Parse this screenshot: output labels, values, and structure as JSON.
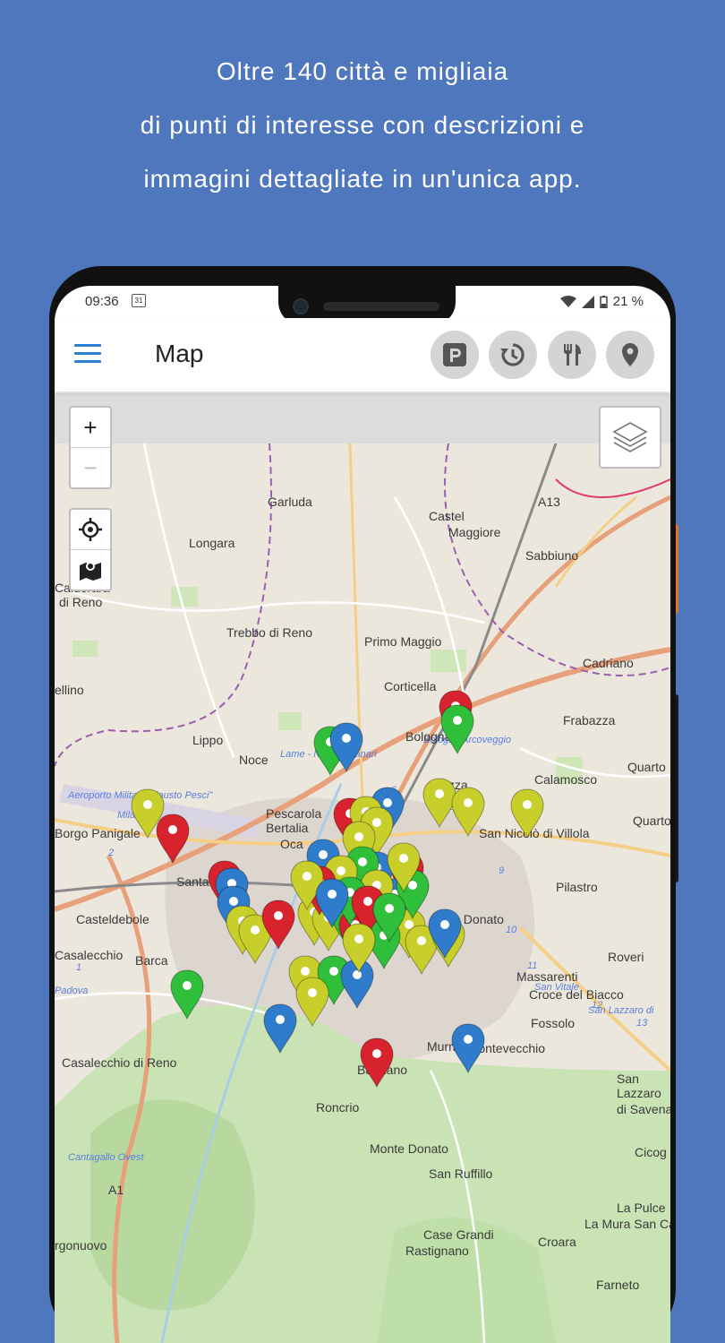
{
  "promo": {
    "line1": "Oltre 140 città e migliaia",
    "line2": "di punti di interesse con descrizioni e",
    "line3": "immagini dettagliate in un'unica app."
  },
  "status_bar": {
    "time": "09:36",
    "calendar_day": "31",
    "battery": "21 %"
  },
  "app_bar": {
    "title": "Map",
    "actions": [
      "parking-icon",
      "history-icon",
      "restaurant-icon",
      "location-pin-icon"
    ]
  },
  "map_controls": {
    "zoom_in": "+",
    "zoom_out": "−"
  },
  "map_labels": [
    "Garluda",
    "Castel",
    "Maggiore",
    "Longara",
    "Sabbiuno",
    "Calderara",
    "di Reno",
    "Trebbo di Reno",
    "Primo Maggio",
    "Cadriano",
    "ellino",
    "Corticella",
    "Frabazza",
    "Lippo",
    "Bologna Arcoveggio",
    "Noce",
    "Lame - Navile - Tanari",
    "Dozza",
    "Quarto In",
    "Calamosco",
    "Aeroporto Militare \"Fausto Pesci\"",
    "Milano",
    "Ferrara",
    "Pescarola",
    "Bertalia",
    "Oca",
    "San Nicolò di Villola",
    "Quarto Sup",
    "Borgo Panigale",
    "Bolognina",
    "San Donato",
    "Pilastro",
    "Santa Viola",
    "Casteldebole",
    "Barca",
    "Roveri",
    "Massarenti",
    "Croce del Biacco",
    "Casalecchio",
    "Padova",
    "Fossolo",
    "San Lazzaro di",
    "Murri",
    "Pontevecchio",
    "Casalecchio di Reno",
    "San",
    "Lazzaro",
    "di Savena",
    "Barbiano",
    "Roncrio",
    "Monte Donato",
    "Cicog",
    "San Ruffillo",
    "Cantagallo Ovest",
    "A1",
    "La Pulce",
    "La Mura San Carlo",
    "Croara",
    "Case Grandi",
    "Rastignano",
    "rgonuovo",
    "Farneto",
    "A13",
    "Bologna",
    "San Vitale",
    "10",
    "11",
    "12",
    "13",
    "9",
    "7",
    "6",
    "4",
    "2",
    "1"
  ],
  "colors": {
    "background": "#4f77bd",
    "accent": "#2d7fd3",
    "pin_green": "#2fbf3a",
    "pin_red": "#d8232f",
    "pin_blue": "#2f7ccc",
    "pin_yellow": "#c8cf2a"
  }
}
